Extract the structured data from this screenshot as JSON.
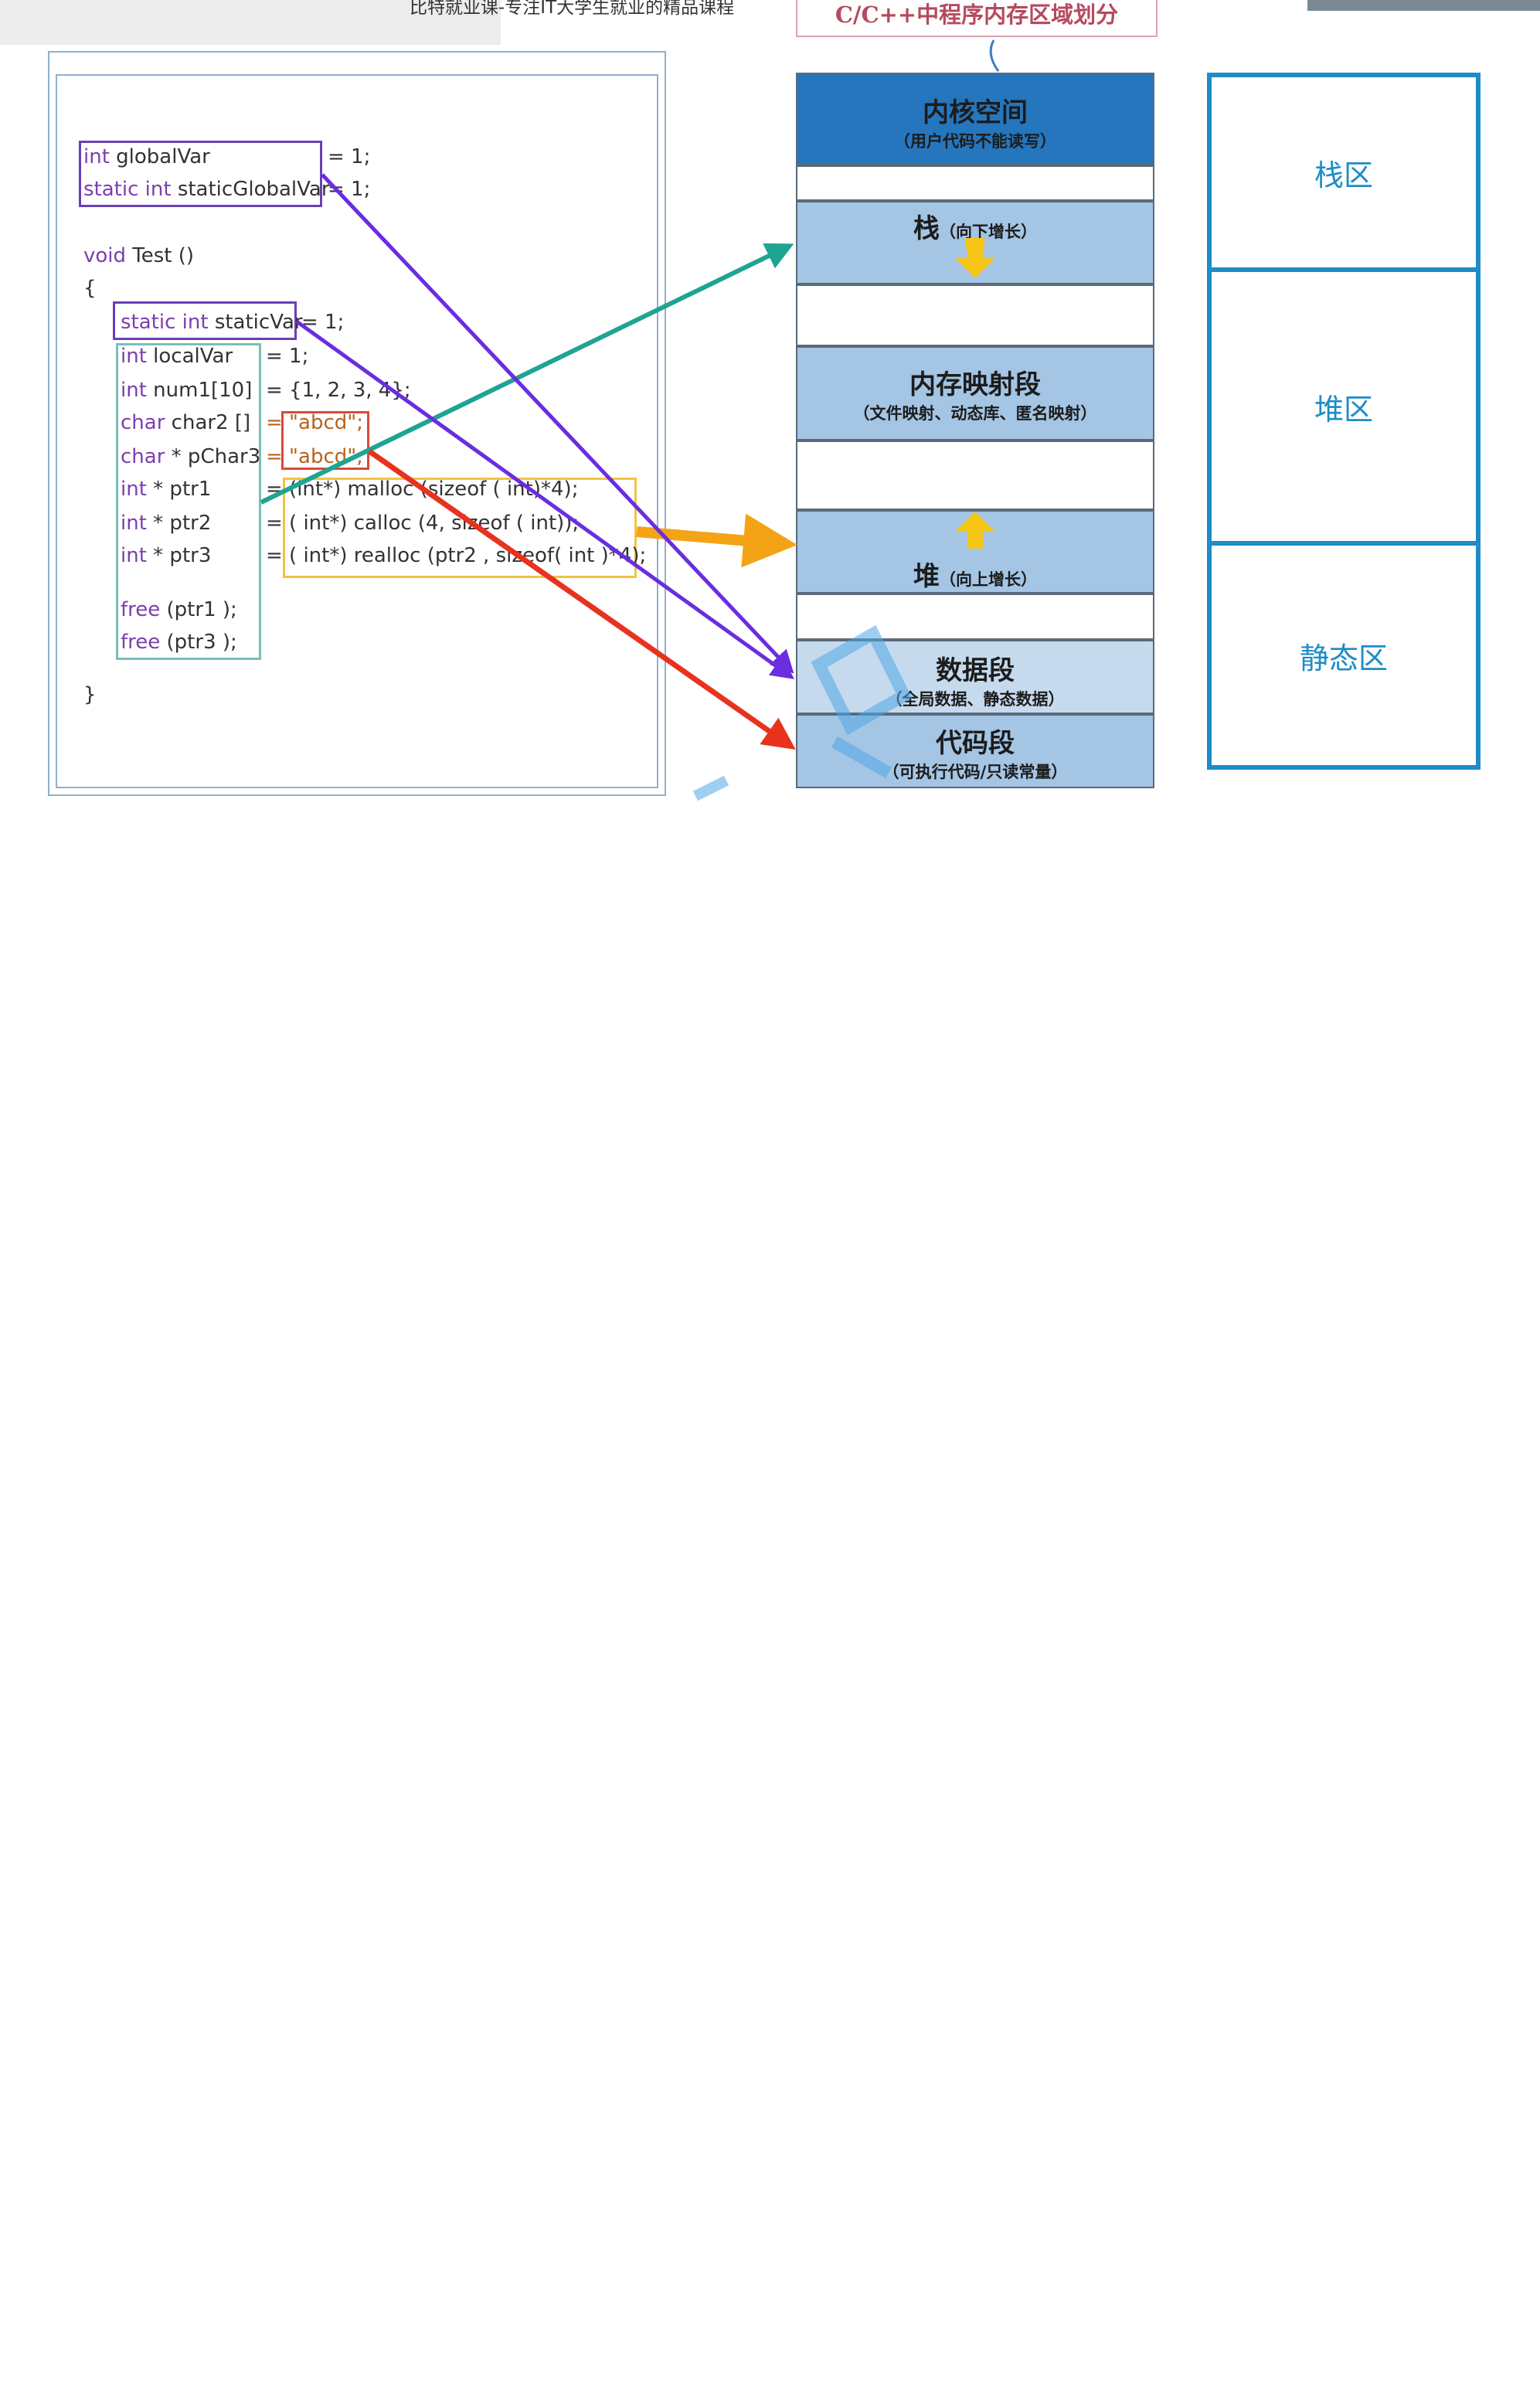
{
  "header": {
    "caption": "比特就业课-专注IT大学生就业的精品课程",
    "diagram_title": "C/C++中程序内存区域划分"
  },
  "code": {
    "lines": [
      {
        "type": "int",
        "name": "globalVar",
        "value": "= 1;"
      },
      {
        "type": "static int",
        "name": "staticGlobalVar",
        "value": "= 1;"
      },
      {
        "type": "void",
        "name": "Test ()",
        "value": ""
      },
      {
        "type": "",
        "name": "{",
        "value": ""
      },
      {
        "type": "static int",
        "name": "staticVar",
        "value": "= 1;"
      },
      {
        "type": "int",
        "name": "localVar",
        "value": "= 1;"
      },
      {
        "type": "int",
        "name": "num1[10]",
        "value": "= {1, 2, 3, 4};"
      },
      {
        "type": "char",
        "name": "char2 []",
        "value": "= \"abcd\";"
      },
      {
        "type": "char",
        "name": "* pChar3",
        "value": "= \"abcd\";"
      },
      {
        "type": "int",
        "name": "* ptr1",
        "value": "= (int*) malloc (sizeof ( int)*4);"
      },
      {
        "type": "int",
        "name": "* ptr2",
        "value": "= ( int*) calloc (4, sizeof ( int));"
      },
      {
        "type": "int",
        "name": "* ptr3",
        "value": "= ( int*) realloc (ptr2 , sizeof( int )*4);"
      },
      {
        "type": "free",
        "name": "(ptr1 );",
        "value": ""
      },
      {
        "type": "free",
        "name": "(ptr3 );",
        "value": ""
      },
      {
        "type": "",
        "name": "}",
        "value": ""
      }
    ]
  },
  "memory_segments": [
    {
      "title": "内核空间",
      "subtitle": "（用户代码不能读写）"
    },
    {
      "title": "栈",
      "subtitle": "（向下增长）"
    },
    {
      "title": "内存映射段",
      "subtitle": "（文件映射、动态库、匿名映射）"
    },
    {
      "title": "堆",
      "subtitle": "（向上增长）"
    },
    {
      "title": "数据段",
      "subtitle": "（全局数据、静态数据）"
    },
    {
      "title": "代码段",
      "subtitle": "（可执行代码/只读常量）"
    }
  ],
  "regions": [
    {
      "label": "栈区"
    },
    {
      "label": "堆区"
    },
    {
      "label": "静态区"
    }
  ],
  "colors": {
    "kernel_blue": "#2576bd",
    "segment_blue": "#a4c5e4",
    "data_blue": "#c6daee",
    "region_border": "#1d8cc7",
    "arrow_teal": "#1fa393",
    "arrow_orange": "#f5a316",
    "arrow_purple": "#6a2de0",
    "arrow_red": "#e8321e",
    "box_purple": "#6a3fb8",
    "box_teal": "#79c0b8",
    "box_red": "#d84a38",
    "box_yellow": "#f2c243"
  }
}
